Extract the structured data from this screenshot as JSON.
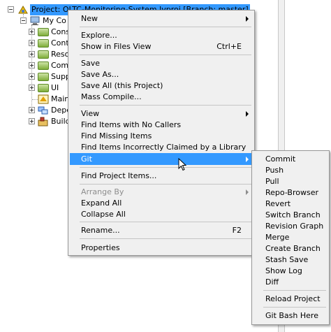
{
  "tree": {
    "project_label": "Project: OLTC-Monitoring-System.lvproj [Branch: master]",
    "computer_label": "My Co",
    "items": [
      {
        "label": "Cons",
        "icon": "folder-icon"
      },
      {
        "label": "Cont",
        "icon": "folder-icon"
      },
      {
        "label": "Reso",
        "icon": "folder-icon"
      },
      {
        "label": "Com",
        "icon": "folder-icon"
      },
      {
        "label": "Supp",
        "icon": "folder-icon"
      },
      {
        "label": "UI",
        "icon": "folder-icon"
      },
      {
        "label": "Main",
        "icon": "vi-icon"
      },
      {
        "label": "Depe",
        "icon": "dependencies-icon"
      },
      {
        "label": "Build",
        "icon": "build-icon"
      }
    ]
  },
  "context_menu": {
    "items": [
      {
        "label": "New",
        "submenu": true
      },
      {
        "label": "Explore..."
      },
      {
        "label": "Show in Files View",
        "shortcut": "Ctrl+E"
      },
      {
        "label": "Save"
      },
      {
        "label": "Save As..."
      },
      {
        "label": "Save All (this Project)"
      },
      {
        "label": "Mass Compile..."
      },
      {
        "label": "View",
        "submenu": true
      },
      {
        "label": "Find Items with No Callers"
      },
      {
        "label": "Find Missing Items"
      },
      {
        "label": "Find Items Incorrectly Claimed by a Library"
      },
      {
        "label": "Git",
        "submenu": true,
        "highlighted": true
      },
      {
        "label": "Find Project Items..."
      },
      {
        "label": "Arrange By",
        "submenu": true,
        "disabled": true
      },
      {
        "label": "Expand All"
      },
      {
        "label": "Collapse All"
      },
      {
        "label": "Rename...",
        "shortcut": "F2"
      },
      {
        "label": "Properties"
      }
    ]
  },
  "git_submenu": {
    "items": [
      {
        "label": "Commit"
      },
      {
        "label": "Push"
      },
      {
        "label": "Pull"
      },
      {
        "label": "Repo-Browser"
      },
      {
        "label": "Revert"
      },
      {
        "label": "Switch Branch"
      },
      {
        "label": "Revision Graph"
      },
      {
        "label": "Merge"
      },
      {
        "label": "Create Branch"
      },
      {
        "label": "Stash Save"
      },
      {
        "label": "Show Log"
      },
      {
        "label": "Diff"
      },
      {
        "label": "Reload Project"
      },
      {
        "label": "Git Bash Here"
      }
    ]
  },
  "colors": {
    "highlight": "#3399ff",
    "menu_bg": "#f0f0f0",
    "disabled_text": "#8d8d8d"
  }
}
